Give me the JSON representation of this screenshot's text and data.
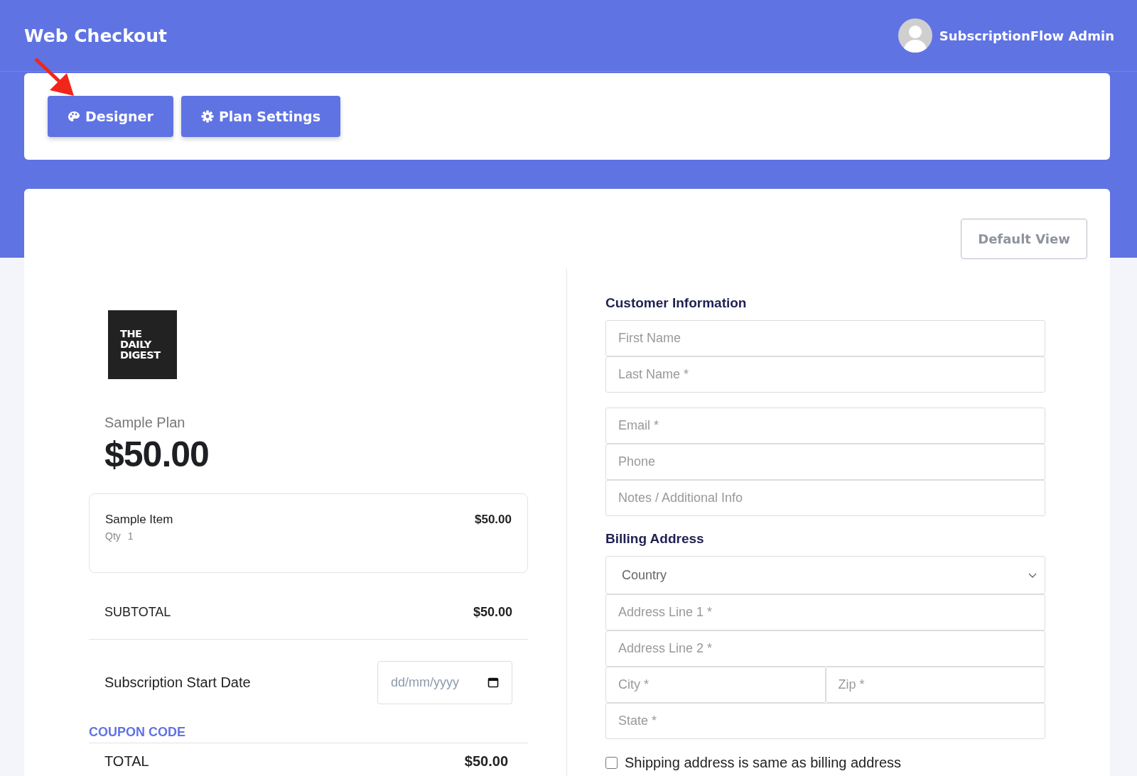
{
  "header": {
    "title": "Web Checkout",
    "user": "SubscriptionFlow Admin"
  },
  "toolbar": {
    "buttons": [
      {
        "label": "Designer"
      },
      {
        "label": "Plan Settings"
      }
    ]
  },
  "view_button": "Default View",
  "summary": {
    "logo": [
      "THE",
      "DAILY",
      "DIGEST"
    ],
    "plan": "Sample Plan",
    "price": "$50.00",
    "items": [
      {
        "name": "Sample Item",
        "qty_label": "Qty",
        "qty": "1",
        "price": "$50.00"
      }
    ],
    "subtotal_label": "SUBTOTAL",
    "subtotal": "$50.00",
    "start_date_label": "Subscription Start Date",
    "start_date": {
      "placeholder": "dd/mm/yyyy"
    },
    "coupon": "COUPON CODE",
    "total_label": "TOTAL",
    "total": "$50.00"
  },
  "customer": {
    "heading": "Customer Information",
    "groups": [
      [
        {
          "placeholder": "First Name"
        },
        {
          "placeholder": "Last Name *"
        }
      ],
      [
        {
          "placeholder": "Email *"
        },
        {
          "placeholder": "Phone"
        },
        {
          "placeholder": "Notes / Additional Info"
        }
      ]
    ]
  },
  "billing": {
    "heading": "Billing Address",
    "rows": [
      [
        {
          "kind": "select",
          "value": "Country"
        }
      ],
      [
        {
          "kind": "text",
          "placeholder": "Address Line 1 *"
        }
      ],
      [
        {
          "kind": "text",
          "placeholder": "Address Line 2 *"
        }
      ],
      [
        {
          "kind": "text",
          "placeholder": "City *"
        },
        {
          "kind": "text",
          "placeholder": "Zip *"
        }
      ],
      [
        {
          "kind": "text",
          "placeholder": "State *"
        }
      ]
    ]
  },
  "shipping_same": {
    "label": "Shipping address is same as billing address",
    "checked": false
  }
}
